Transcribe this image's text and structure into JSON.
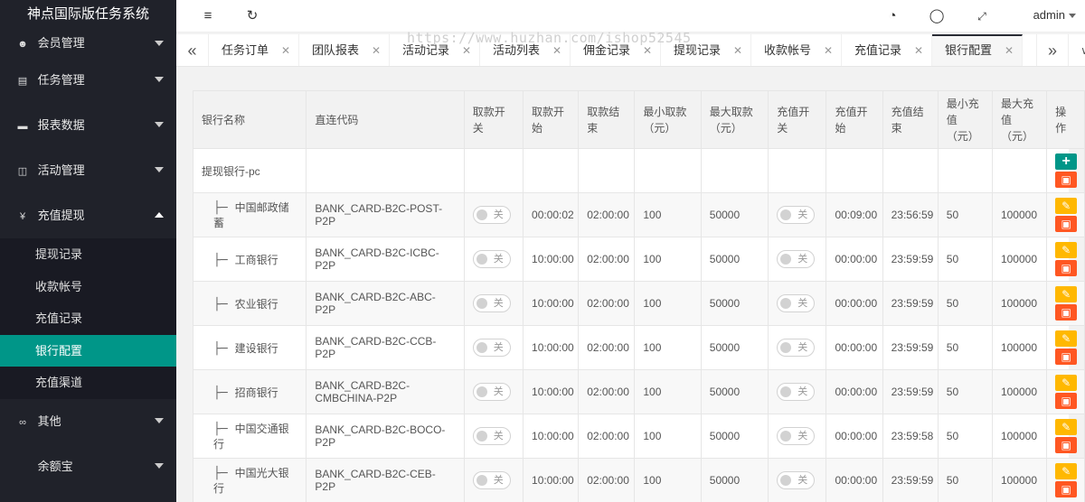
{
  "app": {
    "title": "神点国际版任务系统"
  },
  "sidebar": {
    "items": [
      {
        "label": "会员管理",
        "icon": "user-icon"
      },
      {
        "label": "任务管理",
        "icon": "document-icon"
      },
      {
        "label": "报表数据",
        "icon": "book-icon"
      },
      {
        "label": "活动管理",
        "icon": "read-icon"
      },
      {
        "label": "充值提现",
        "icon": "yen-icon"
      }
    ],
    "sub_items": [
      {
        "label": "提现记录"
      },
      {
        "label": "收款帐号"
      },
      {
        "label": "充值记录"
      },
      {
        "label": "银行配置"
      },
      {
        "label": "充值渠道"
      }
    ],
    "bottom_items": [
      {
        "label": "其他",
        "icon": "infinity-icon"
      },
      {
        "label": "余额宝",
        "icon": ""
      }
    ]
  },
  "header": {
    "user": "admin"
  },
  "watermark": "https://www.huzhan.com/ishop52545",
  "tabs": [
    {
      "label": "任务订单"
    },
    {
      "label": "团队报表"
    },
    {
      "label": "活动记录"
    },
    {
      "label": "活动列表"
    },
    {
      "label": "佣金记录"
    },
    {
      "label": "提现记录"
    },
    {
      "label": "收款帐号"
    },
    {
      "label": "充值记录"
    },
    {
      "label": "银行配置"
    }
  ],
  "table": {
    "headers": {
      "bank_name": "银行名称",
      "code": "直连代码",
      "wd_switch": "取款开关",
      "wd_start": "取款开始",
      "wd_end": "取款结束",
      "wd_min": "最小取款（元）",
      "wd_max": "最大取款（元）",
      "dep_switch": "充值开关",
      "dep_start": "充值开始",
      "dep_end": "充值结束",
      "dep_min": "最小充值（元）",
      "dep_max": "最大充值（元）",
      "ops": "操作"
    },
    "group": {
      "name": "提现银行-pc"
    },
    "switch_off": "关",
    "tree_glyph": "├─",
    "rows": [
      {
        "name": "中国邮政储蓄",
        "code": "BANK_CARD-B2C-POST-P2P",
        "wd_start": "00:00:02",
        "wd_end": "02:00:00",
        "wd_min": "100",
        "wd_max": "50000",
        "dep_start": "00:09:00",
        "dep_end": "23:56:59",
        "dep_min": "50",
        "dep_max": "100000"
      },
      {
        "name": "工商银行",
        "code": "BANK_CARD-B2C-ICBC-P2P",
        "wd_start": "10:00:00",
        "wd_end": "02:00:00",
        "wd_min": "100",
        "wd_max": "50000",
        "dep_start": "00:00:00",
        "dep_end": "23:59:59",
        "dep_min": "50",
        "dep_max": "100000"
      },
      {
        "name": "农业银行",
        "code": "BANK_CARD-B2C-ABC-P2P",
        "wd_start": "10:00:00",
        "wd_end": "02:00:00",
        "wd_min": "100",
        "wd_max": "50000",
        "dep_start": "00:00:00",
        "dep_end": "23:59:59",
        "dep_min": "50",
        "dep_max": "100000"
      },
      {
        "name": "建设银行",
        "code": "BANK_CARD-B2C-CCB-P2P",
        "wd_start": "10:00:00",
        "wd_end": "02:00:00",
        "wd_min": "100",
        "wd_max": "50000",
        "dep_start": "00:00:00",
        "dep_end": "23:59:59",
        "dep_min": "50",
        "dep_max": "100000"
      },
      {
        "name": "招商银行",
        "code": "BANK_CARD-B2C-CMBCHINA-P2P",
        "wd_start": "10:00:00",
        "wd_end": "02:00:00",
        "wd_min": "100",
        "wd_max": "50000",
        "dep_start": "00:00:00",
        "dep_end": "23:59:59",
        "dep_min": "50",
        "dep_max": "100000"
      },
      {
        "name": "中国交通银行",
        "code": "BANK_CARD-B2C-BOCO-P2P",
        "wd_start": "10:00:00",
        "wd_end": "02:00:00",
        "wd_min": "100",
        "wd_max": "50000",
        "dep_start": "00:00:00",
        "dep_end": "23:59:58",
        "dep_min": "50",
        "dep_max": "100000"
      },
      {
        "name": "中国光大银行",
        "code": "BANK_CARD-B2C-CEB-P2P",
        "wd_start": "10:00:00",
        "wd_end": "02:00:00",
        "wd_min": "100",
        "wd_max": "50000",
        "dep_start": "00:00:00",
        "dep_end": "23:59:59",
        "dep_min": "50",
        "dep_max": "100000"
      }
    ]
  },
  "colors": {
    "sidebar_bg": "#20222a",
    "active": "#009688",
    "edit": "#ffb800",
    "delete": "#ff5722"
  }
}
